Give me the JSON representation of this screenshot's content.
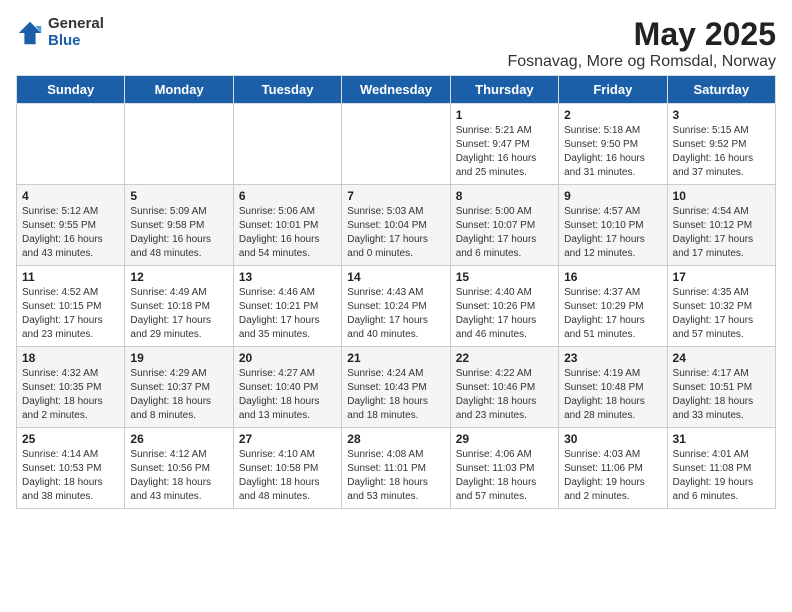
{
  "logo": {
    "general": "General",
    "blue": "Blue"
  },
  "title": "May 2025",
  "subtitle": "Fosnavag, More og Romsdal, Norway",
  "days_of_week": [
    "Sunday",
    "Monday",
    "Tuesday",
    "Wednesday",
    "Thursday",
    "Friday",
    "Saturday"
  ],
  "weeks": [
    [
      {
        "num": "",
        "content": ""
      },
      {
        "num": "",
        "content": ""
      },
      {
        "num": "",
        "content": ""
      },
      {
        "num": "",
        "content": ""
      },
      {
        "num": "1",
        "content": "Sunrise: 5:21 AM\nSunset: 9:47 PM\nDaylight: 16 hours\nand 25 minutes."
      },
      {
        "num": "2",
        "content": "Sunrise: 5:18 AM\nSunset: 9:50 PM\nDaylight: 16 hours\nand 31 minutes."
      },
      {
        "num": "3",
        "content": "Sunrise: 5:15 AM\nSunset: 9:52 PM\nDaylight: 16 hours\nand 37 minutes."
      }
    ],
    [
      {
        "num": "4",
        "content": "Sunrise: 5:12 AM\nSunset: 9:55 PM\nDaylight: 16 hours\nand 43 minutes."
      },
      {
        "num": "5",
        "content": "Sunrise: 5:09 AM\nSunset: 9:58 PM\nDaylight: 16 hours\nand 48 minutes."
      },
      {
        "num": "6",
        "content": "Sunrise: 5:06 AM\nSunset: 10:01 PM\nDaylight: 16 hours\nand 54 minutes."
      },
      {
        "num": "7",
        "content": "Sunrise: 5:03 AM\nSunset: 10:04 PM\nDaylight: 17 hours\nand 0 minutes."
      },
      {
        "num": "8",
        "content": "Sunrise: 5:00 AM\nSunset: 10:07 PM\nDaylight: 17 hours\nand 6 minutes."
      },
      {
        "num": "9",
        "content": "Sunrise: 4:57 AM\nSunset: 10:10 PM\nDaylight: 17 hours\nand 12 minutes."
      },
      {
        "num": "10",
        "content": "Sunrise: 4:54 AM\nSunset: 10:12 PM\nDaylight: 17 hours\nand 17 minutes."
      }
    ],
    [
      {
        "num": "11",
        "content": "Sunrise: 4:52 AM\nSunset: 10:15 PM\nDaylight: 17 hours\nand 23 minutes."
      },
      {
        "num": "12",
        "content": "Sunrise: 4:49 AM\nSunset: 10:18 PM\nDaylight: 17 hours\nand 29 minutes."
      },
      {
        "num": "13",
        "content": "Sunrise: 4:46 AM\nSunset: 10:21 PM\nDaylight: 17 hours\nand 35 minutes."
      },
      {
        "num": "14",
        "content": "Sunrise: 4:43 AM\nSunset: 10:24 PM\nDaylight: 17 hours\nand 40 minutes."
      },
      {
        "num": "15",
        "content": "Sunrise: 4:40 AM\nSunset: 10:26 PM\nDaylight: 17 hours\nand 46 minutes."
      },
      {
        "num": "16",
        "content": "Sunrise: 4:37 AM\nSunset: 10:29 PM\nDaylight: 17 hours\nand 51 minutes."
      },
      {
        "num": "17",
        "content": "Sunrise: 4:35 AM\nSunset: 10:32 PM\nDaylight: 17 hours\nand 57 minutes."
      }
    ],
    [
      {
        "num": "18",
        "content": "Sunrise: 4:32 AM\nSunset: 10:35 PM\nDaylight: 18 hours\nand 2 minutes."
      },
      {
        "num": "19",
        "content": "Sunrise: 4:29 AM\nSunset: 10:37 PM\nDaylight: 18 hours\nand 8 minutes."
      },
      {
        "num": "20",
        "content": "Sunrise: 4:27 AM\nSunset: 10:40 PM\nDaylight: 18 hours\nand 13 minutes."
      },
      {
        "num": "21",
        "content": "Sunrise: 4:24 AM\nSunset: 10:43 PM\nDaylight: 18 hours\nand 18 minutes."
      },
      {
        "num": "22",
        "content": "Sunrise: 4:22 AM\nSunset: 10:46 PM\nDaylight: 18 hours\nand 23 minutes."
      },
      {
        "num": "23",
        "content": "Sunrise: 4:19 AM\nSunset: 10:48 PM\nDaylight: 18 hours\nand 28 minutes."
      },
      {
        "num": "24",
        "content": "Sunrise: 4:17 AM\nSunset: 10:51 PM\nDaylight: 18 hours\nand 33 minutes."
      }
    ],
    [
      {
        "num": "25",
        "content": "Sunrise: 4:14 AM\nSunset: 10:53 PM\nDaylight: 18 hours\nand 38 minutes."
      },
      {
        "num": "26",
        "content": "Sunrise: 4:12 AM\nSunset: 10:56 PM\nDaylight: 18 hours\nand 43 minutes."
      },
      {
        "num": "27",
        "content": "Sunrise: 4:10 AM\nSunset: 10:58 PM\nDaylight: 18 hours\nand 48 minutes."
      },
      {
        "num": "28",
        "content": "Sunrise: 4:08 AM\nSunset: 11:01 PM\nDaylight: 18 hours\nand 53 minutes."
      },
      {
        "num": "29",
        "content": "Sunrise: 4:06 AM\nSunset: 11:03 PM\nDaylight: 18 hours\nand 57 minutes."
      },
      {
        "num": "30",
        "content": "Sunrise: 4:03 AM\nSunset: 11:06 PM\nDaylight: 19 hours\nand 2 minutes."
      },
      {
        "num": "31",
        "content": "Sunrise: 4:01 AM\nSunset: 11:08 PM\nDaylight: 19 hours\nand 6 minutes."
      }
    ]
  ]
}
